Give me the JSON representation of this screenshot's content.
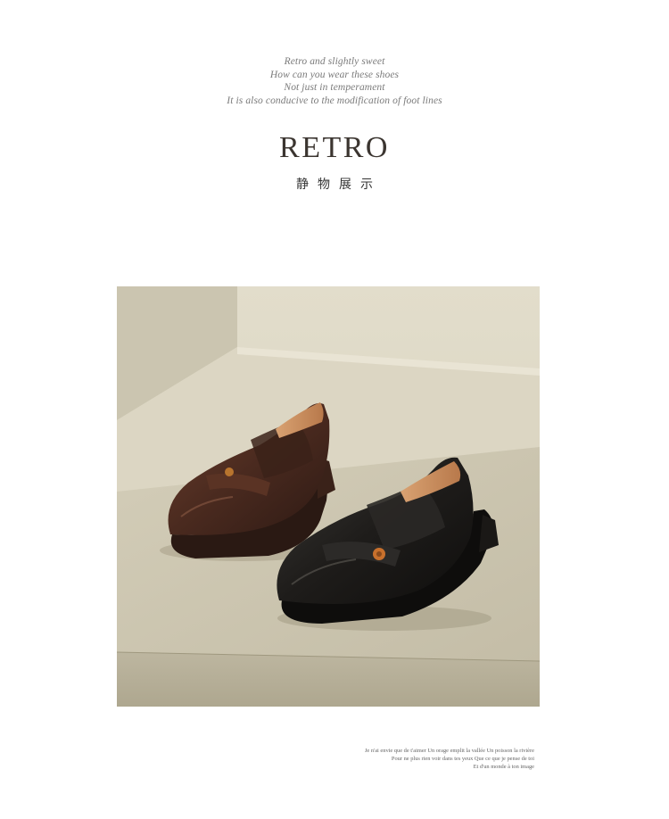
{
  "intro": {
    "lines": [
      "Retro and slightly sweet",
      "How can you wear these shoes",
      "Not just in temperament",
      "It is also conducive to the modification of foot lines"
    ]
  },
  "header": {
    "title": "RETRO",
    "subtitle": "静物展示"
  },
  "colors": {
    "title": "#3b3530",
    "backdrop": "#d8d3c0",
    "brown_shoe": "#4a2a1f",
    "black_shoe": "#1e1c1a",
    "button_accent": "#c8702c"
  },
  "caption": {
    "lines": [
      "Je n'ai envie que de t'aimer Un orage emplit la vallée Un poisson la rivière",
      "Pour ne plus rien voir dans tes yeux Que ce que je pense de toi",
      "Et d'un monde à ton image"
    ]
  }
}
